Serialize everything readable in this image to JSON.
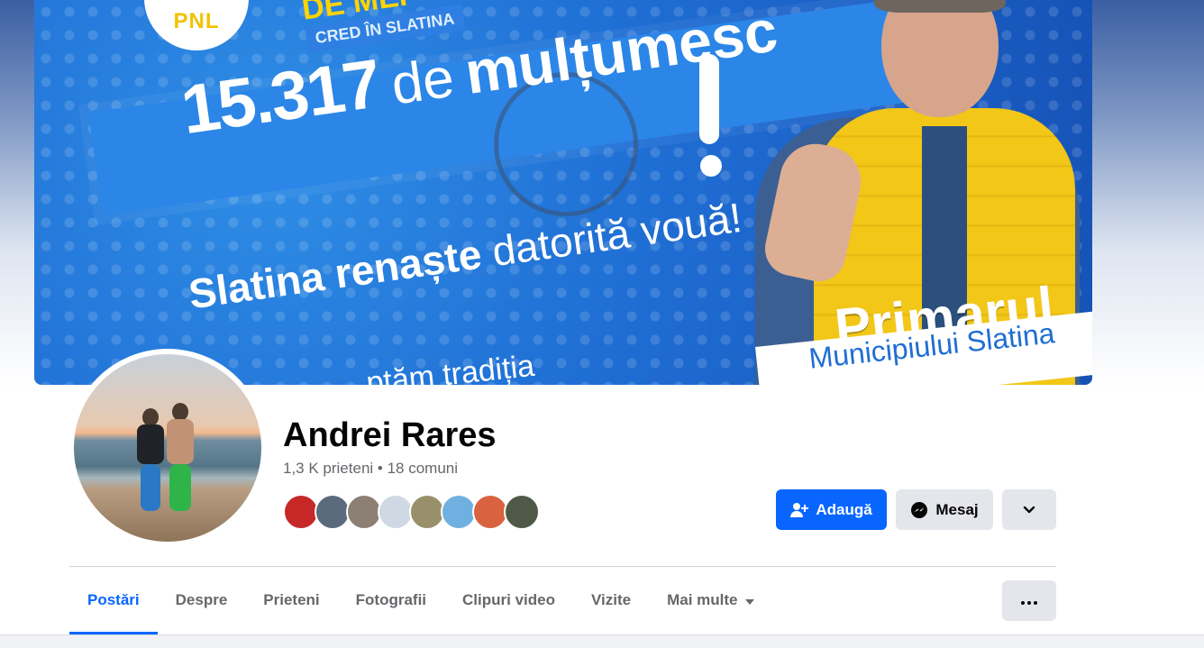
{
  "cover": {
    "badge": "PNL",
    "slogan_line1": "DE MEI",
    "slogan_line2": "CRED ÎN SLATINA",
    "big_number": "15.317",
    "big_de": "de",
    "big_word": "mulțumesc",
    "renaste_bold": "Slatina renaște",
    "renaste_rest": "datorită vouă!",
    "bottom_text": "...ptăm tradiția",
    "primarul": "Primarul",
    "municipiu": "Municipiului Slatina"
  },
  "profile": {
    "name": "Andrei Rares",
    "stats": "1,3 K prieteni • 18 comuni",
    "friend_avatar_colors": [
      "#c62828",
      "#5b6b7d",
      "#8c8074",
      "#cfd8e3",
      "#9a8f6b",
      "#6fb0e0",
      "#d9633f",
      "#4e5a47"
    ]
  },
  "actions": {
    "add_label": "Adaugă",
    "message_label": "Mesaj"
  },
  "tabs": [
    {
      "label": "Postări",
      "active": true
    },
    {
      "label": "Despre"
    },
    {
      "label": "Prieteni"
    },
    {
      "label": "Fotografii"
    },
    {
      "label": "Clipuri video"
    },
    {
      "label": "Vizite"
    },
    {
      "label": "Mai multe"
    }
  ],
  "colors": {
    "accent": "#0866ff",
    "secondary_button": "#e4e6eb",
    "text_primary": "#050505",
    "text_secondary": "#65676b"
  },
  "icons": [
    "add-friend-icon",
    "messenger-icon",
    "chevron-down-icon",
    "caret-down-icon",
    "more-dots-icon"
  ]
}
